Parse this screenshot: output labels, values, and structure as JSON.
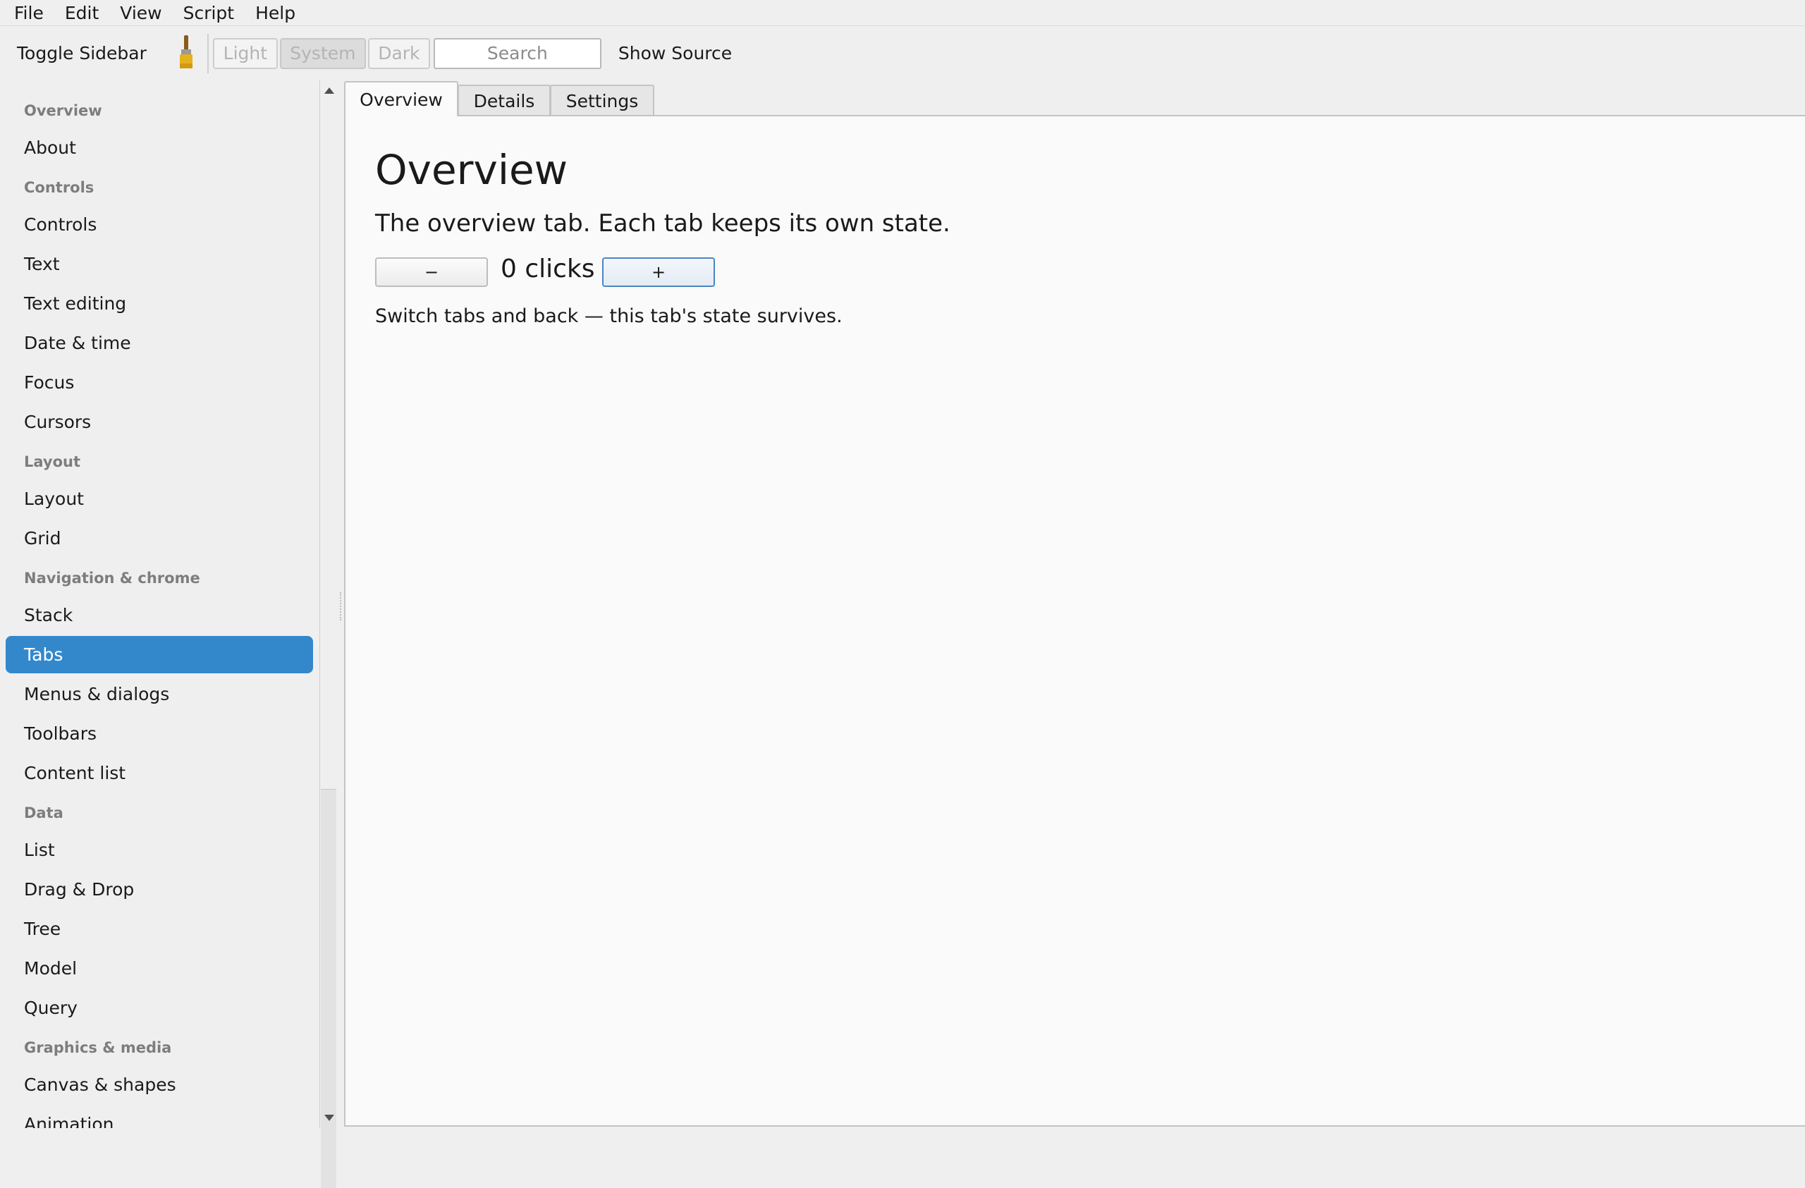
{
  "menu": [
    "File",
    "Edit",
    "View",
    "Script",
    "Help"
  ],
  "toolbar": {
    "toggle_sidebar": "Toggle Sidebar",
    "theme_light": "Light",
    "theme_system": "System",
    "theme_dark": "Dark",
    "search_placeholder": "Search",
    "show_source": "Show Source"
  },
  "sidebar": {
    "items": [
      {
        "label": "Overview",
        "type": "header"
      },
      {
        "label": "About",
        "type": "item"
      },
      {
        "label": "Controls",
        "type": "header"
      },
      {
        "label": "Controls",
        "type": "item"
      },
      {
        "label": "Text",
        "type": "item"
      },
      {
        "label": "Text editing",
        "type": "item"
      },
      {
        "label": "Date & time",
        "type": "item"
      },
      {
        "label": "Focus",
        "type": "item"
      },
      {
        "label": "Cursors",
        "type": "item"
      },
      {
        "label": "Layout",
        "type": "header"
      },
      {
        "label": "Layout",
        "type": "item"
      },
      {
        "label": "Grid",
        "type": "item"
      },
      {
        "label": "Navigation & chrome",
        "type": "header"
      },
      {
        "label": "Stack",
        "type": "item"
      },
      {
        "label": "Tabs",
        "type": "item",
        "selected": true
      },
      {
        "label": "Menus & dialogs",
        "type": "item"
      },
      {
        "label": "Toolbars",
        "type": "item"
      },
      {
        "label": "Content list",
        "type": "item"
      },
      {
        "label": "Data",
        "type": "header"
      },
      {
        "label": "List",
        "type": "item"
      },
      {
        "label": "Drag & Drop",
        "type": "item"
      },
      {
        "label": "Tree",
        "type": "item"
      },
      {
        "label": "Model",
        "type": "item"
      },
      {
        "label": "Query",
        "type": "item"
      },
      {
        "label": "Graphics & media",
        "type": "header"
      },
      {
        "label": "Canvas & shapes",
        "type": "item"
      },
      {
        "label": "Animation",
        "type": "item"
      }
    ]
  },
  "tabs": [
    {
      "label": "Overview",
      "active": true
    },
    {
      "label": "Details",
      "active": false
    },
    {
      "label": "Settings",
      "active": false
    }
  ],
  "content": {
    "title": "Overview",
    "description": "The overview tab. Each tab keeps its own state.",
    "minus_label": "−",
    "plus_label": "+",
    "count_text": "0 clicks",
    "note": "Switch tabs and back — this tab's state survives."
  },
  "colors": {
    "selection": "#3388cc",
    "focus_border": "#4a86c0"
  }
}
